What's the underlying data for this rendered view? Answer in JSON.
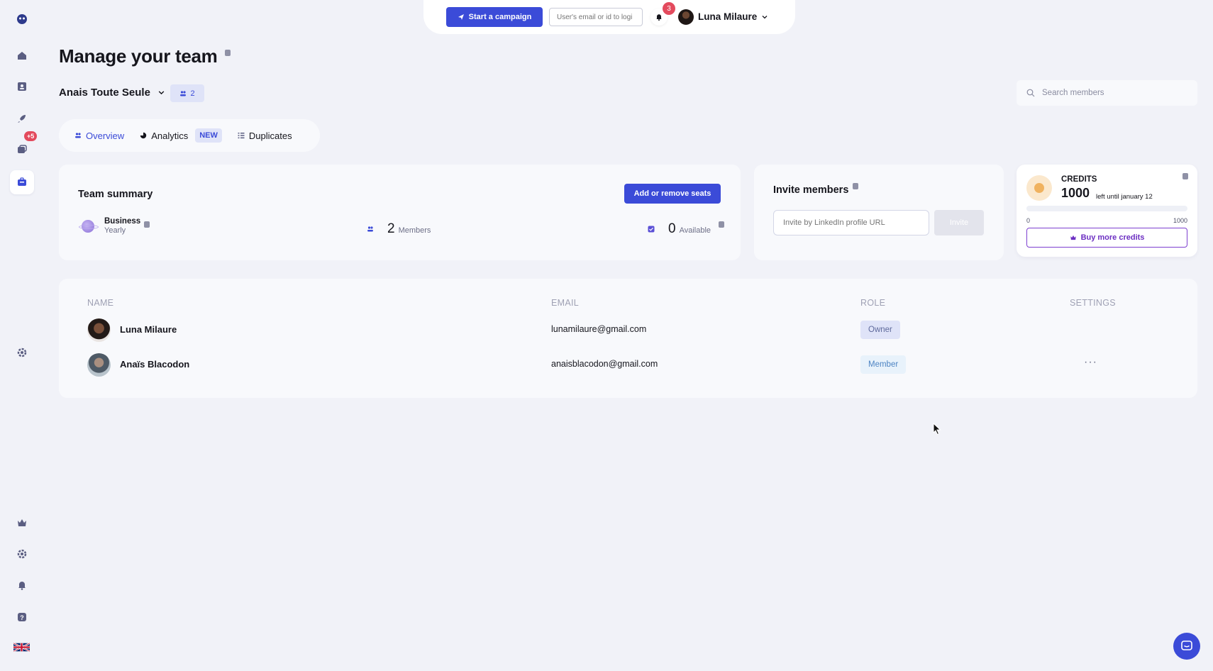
{
  "topbar": {
    "start_campaign": "Start a campaign",
    "login_placeholder": "User's email or id to logi",
    "notifications_count": "3",
    "user_name": "Luna Milaure"
  },
  "sidebar": {
    "messages_badge": "+5"
  },
  "page": {
    "title": "Manage your team",
    "team_name": "Anais Toute Seule",
    "team_count": "2",
    "search_placeholder": "Search members"
  },
  "tabs": [
    {
      "label": "Overview",
      "active": true
    },
    {
      "label": "Analytics",
      "badge": "NEW"
    },
    {
      "label": "Duplicates"
    }
  ],
  "summary": {
    "title": "Team summary",
    "add_seats": "Add or remove seats",
    "plan_name": "Business",
    "plan_cycle": "Yearly",
    "members_count": "2",
    "members_label": "Members",
    "available_count": "0",
    "available_label": "Available"
  },
  "invite": {
    "title": "Invite members",
    "placeholder": "Invite by LinkedIn profile URL",
    "button": "Invite"
  },
  "credits": {
    "label": "CREDITS",
    "value": "1000",
    "until": "left until january 12",
    "min": "0",
    "max": "1000",
    "used_fraction": 0,
    "buy_button": "Buy more credits"
  },
  "table": {
    "headers": {
      "name": "NAME",
      "email": "EMAIL",
      "role": "ROLE",
      "settings": "SETTINGS"
    },
    "rows": [
      {
        "name": "Luna Milaure",
        "email": "lunamilaure@gmail.com",
        "role": "Owner"
      },
      {
        "name": "Anaïs Blacodon",
        "email": "anaisblacodon@gmail.com",
        "role": "Member",
        "menu": "···"
      }
    ]
  },
  "colors": {
    "primary": "#3b4bd8",
    "badge_red": "#e34a5d",
    "purple": "#7d3fd0",
    "background": "#f1f2f8"
  },
  "icons": [
    "app-logo-icon",
    "home-icon",
    "contacts-icon",
    "rocket-icon",
    "messages-icon",
    "team-icon",
    "settings-icon",
    "crown-icon",
    "gear-icon",
    "bell-icon",
    "help-icon",
    "uk-flag-icon",
    "search-icon",
    "chat-icon"
  ]
}
